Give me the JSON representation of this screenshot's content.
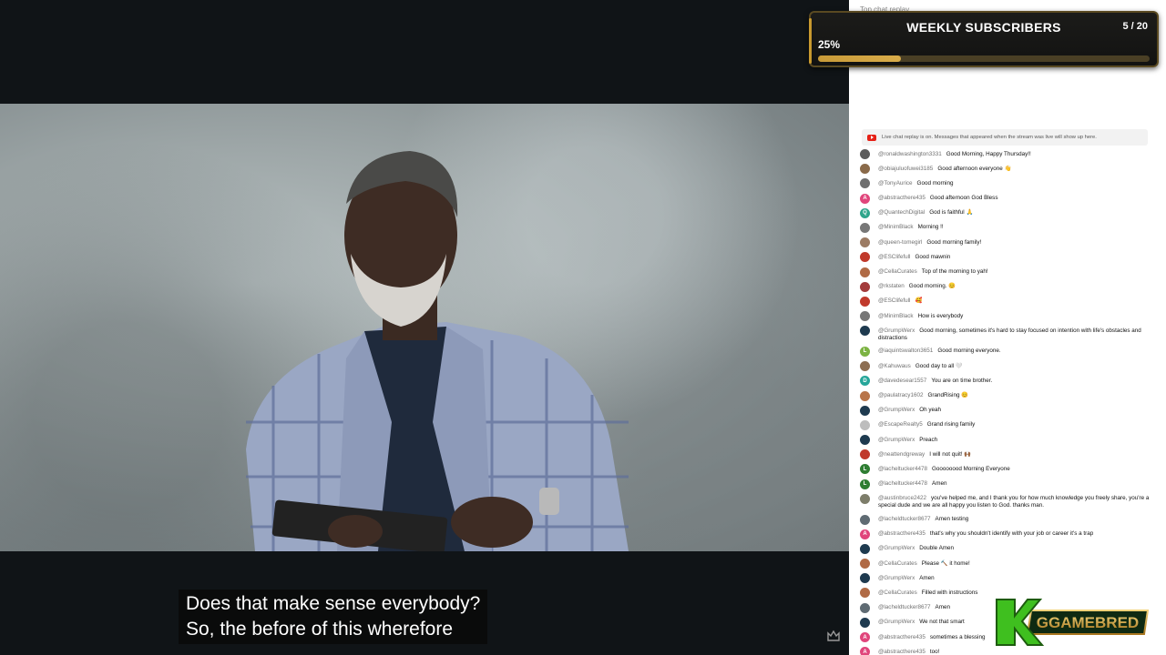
{
  "video": {
    "caption_lines": [
      "Does that make sense everybody?",
      "So, the before of this wherefore"
    ]
  },
  "goal": {
    "title": "WEEKLY SUBSCRIBERS",
    "count": "5 / 20",
    "percent_label": "25%",
    "progress_fraction": 0.25,
    "accent": "#c89a38"
  },
  "chat": {
    "header_ghost": "Top chat replay",
    "replay_notice": "Live chat replay is on. Messages that appeared when the stream was live will show up here.",
    "messages": [
      {
        "author": "@ronaldwashington3331",
        "text": "Good Morning, Happy Thursday!!",
        "avatar_color": "#5b5b5b",
        "initial": ""
      },
      {
        "author": "@obiajuluofuwei3185",
        "text": "Good afternoon everyone 👋",
        "avatar_color": "#8a6a4a",
        "initial": ""
      },
      {
        "author": "@TonyAurice",
        "text": "Good morning",
        "avatar_color": "#6e6e6e",
        "initial": ""
      },
      {
        "author": "@abstracthere435",
        "text": "Good afternoon God Bless",
        "avatar_color": "#e0457b",
        "initial": "A"
      },
      {
        "author": "@QuantechDigital",
        "text": "God is faithful 🙏",
        "avatar_color": "#2fa58b",
        "initial": "Q"
      },
      {
        "author": "@MinimBlack",
        "text": "Morning !!",
        "avatar_color": "#777777",
        "initial": ""
      },
      {
        "author": "@queen-tomegirl",
        "text": "Good morning family!",
        "avatar_color": "#9c7b63",
        "initial": ""
      },
      {
        "author": "@ESClifefull",
        "text": "Good mawnin",
        "avatar_color": "#c0392b",
        "initial": ""
      },
      {
        "author": "@CellaCurates",
        "text": "Top of the morning to yah!",
        "avatar_color": "#b06a45",
        "initial": ""
      },
      {
        "author": "@rkstaten",
        "text": "Good morning. 😊",
        "avatar_color": "#a33b3b",
        "initial": ""
      },
      {
        "author": "@ESClifefull",
        "text": "🥰",
        "avatar_color": "#c0392b",
        "initial": ""
      },
      {
        "author": "@MinimBlack",
        "text": "How is everybody",
        "avatar_color": "#777777",
        "initial": ""
      },
      {
        "author": "@GrumpWerx",
        "text": "Good morning, sometimes it's hard to stay focused on intention with life's obstacles and distractions",
        "avatar_color": "#1e3a4f",
        "initial": ""
      },
      {
        "author": "@iaquintswalton3651",
        "text": "Good morning everyone.",
        "avatar_color": "#7cb342",
        "initial": "L"
      },
      {
        "author": "@Kahuwaus",
        "text": "Good day to all 🤍",
        "avatar_color": "#8d6e52",
        "initial": ""
      },
      {
        "author": "@davedesear1557",
        "text": "You are on time brother.",
        "avatar_color": "#26a69a",
        "initial": "D"
      },
      {
        "author": "@paulatracy1602",
        "text": "GrandRising 😊",
        "avatar_color": "#b8754a",
        "initial": ""
      },
      {
        "author": "@GrumpWerx",
        "text": "Oh yeah",
        "avatar_color": "#1e3a4f",
        "initial": ""
      },
      {
        "author": "@EscapeRealty5",
        "text": "Grand rising family",
        "avatar_color": "#bdbdbd",
        "initial": ""
      },
      {
        "author": "@GrumpWerx",
        "text": "Preach",
        "avatar_color": "#1e3a4f",
        "initial": ""
      },
      {
        "author": "@neattendgreway",
        "text": "I will not quit! 🙌🏾",
        "avatar_color": "#c0392b",
        "initial": ""
      },
      {
        "author": "@lacheltucker4478",
        "text": "Goooooood Morning Everyone",
        "avatar_color": "#2e7d32",
        "initial": "L"
      },
      {
        "author": "@lacheltucker4478",
        "text": "Amen",
        "avatar_color": "#2e7d32",
        "initial": "L"
      },
      {
        "author": "@austinbruce2422",
        "text": "you've helped me, and I thank you for how much knowledge you freely share, you're a special dude and we are all happy you listen to God. thanks man.",
        "avatar_color": "#7d7d6a",
        "initial": ""
      },
      {
        "author": "@lacheldtucker8677",
        "text": "Amen testing",
        "avatar_color": "#5f6b73",
        "initial": ""
      },
      {
        "author": "@abstracthere435",
        "text": "that's why you shouldn't identify with your job or career it's a trap",
        "avatar_color": "#e0457b",
        "initial": "A"
      },
      {
        "author": "@GrumpWerx",
        "text": "Double Amen",
        "avatar_color": "#1e3a4f",
        "initial": ""
      },
      {
        "author": "@CellaCurates",
        "text": "Please 🔨 it home!",
        "avatar_color": "#b06a45",
        "initial": ""
      },
      {
        "author": "@GrumpWerx",
        "text": "Amen",
        "avatar_color": "#1e3a4f",
        "initial": ""
      },
      {
        "author": "@CellaCurates",
        "text": "Filled with instructions",
        "avatar_color": "#b06a45",
        "initial": ""
      },
      {
        "author": "@lacheldtucker8677",
        "text": "Amen",
        "avatar_color": "#5f6b73",
        "initial": ""
      },
      {
        "author": "@GrumpWerx",
        "text": "We not that smart",
        "avatar_color": "#1e3a4f",
        "initial": ""
      },
      {
        "author": "@abstracthere435",
        "text": "sometimes a blessing",
        "avatar_color": "#e0457b",
        "initial": "A"
      },
      {
        "author": "@abstracthere435",
        "text": "too!",
        "avatar_color": "#e0457b",
        "initial": "A"
      }
    ]
  },
  "brand": {
    "logo_text": "GGAMEBRED",
    "logo_letter": "K"
  }
}
